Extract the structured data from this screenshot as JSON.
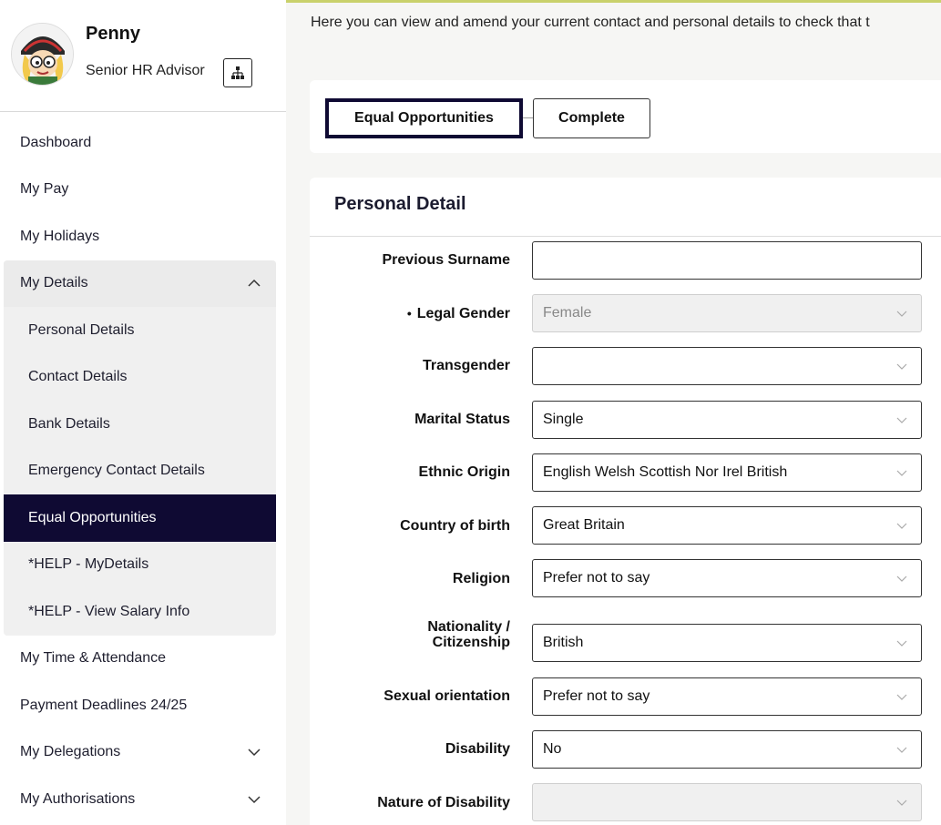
{
  "profile": {
    "name": "Penny",
    "role": "Senior HR Advisor",
    "avatar_icon": "cartoon-avatar",
    "org_icon": "org-chart-icon"
  },
  "nav": {
    "dashboard": "Dashboard",
    "my_pay": "My Pay",
    "my_holidays": "My Holidays",
    "my_details": "My Details",
    "sub": {
      "personal": "Personal Details",
      "contact": "Contact Details",
      "bank": "Bank Details",
      "emergency": "Emergency Contact Details",
      "equal": "Equal Opportunities",
      "help_details": "*HELP - MyDetails",
      "help_salary": "*HELP - View Salary Info"
    },
    "time_attendance": "My Time & Attendance",
    "payment_deadlines": "Payment Deadlines 24/25",
    "delegations": "My Delegations",
    "authorisations": "My Authorisations"
  },
  "main": {
    "intro": "Here you can view and amend your current contact and personal details to check that t",
    "steps": [
      "Equal Opportunities",
      "Complete"
    ],
    "card_title": "Personal Detail",
    "fields": {
      "previous_surname": {
        "label": "Previous Surname",
        "value": ""
      },
      "legal_gender": {
        "required_mark": "•",
        "label": "Legal Gender",
        "value": "Female"
      },
      "transgender": {
        "label": "Transgender",
        "value": ""
      },
      "marital_status": {
        "label": "Marital Status",
        "value": "Single"
      },
      "ethnic_origin": {
        "label": "Ethnic Origin",
        "value": "English Welsh Scottish Nor Irel British"
      },
      "country_of_birth": {
        "label": "Country of birth",
        "value": "Great Britain"
      },
      "religion": {
        "label": "Religion",
        "value": "Prefer not to say"
      },
      "nationality": {
        "label_line1": "Nationality /",
        "label_line2": "Citizenship",
        "value": "British"
      },
      "sexual_orientation": {
        "label": "Sexual orientation",
        "value": "Prefer not to say"
      },
      "disability": {
        "label": "Disability",
        "value": "No"
      },
      "nature_of_disability": {
        "label": "Nature of Disability",
        "value": ""
      }
    }
  },
  "colors": {
    "active_nav": "#0f0a33",
    "accent_line": "#c9d16b",
    "page_bg": "#f6f6f4"
  }
}
